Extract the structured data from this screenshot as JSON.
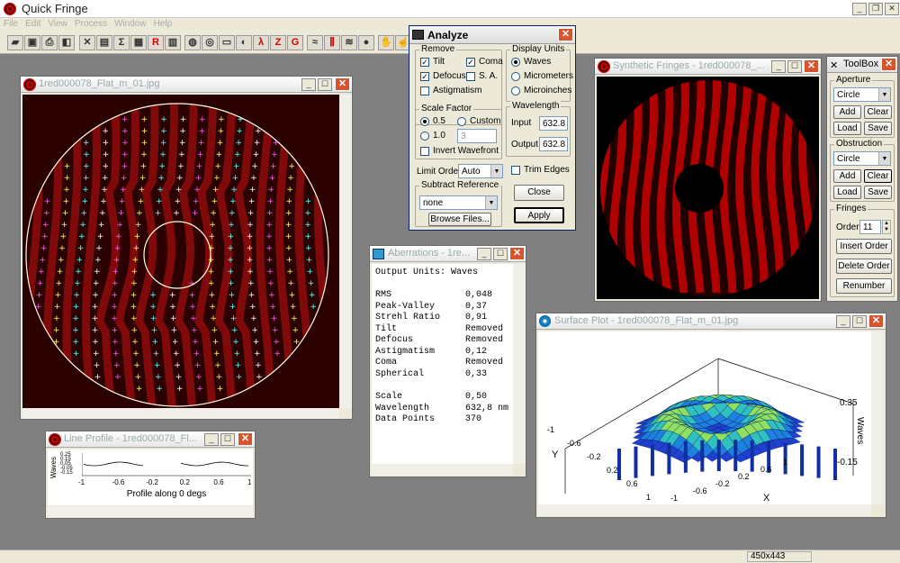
{
  "app": {
    "title": "Quick Fringe"
  },
  "menu": [
    "File",
    "Edit",
    "View",
    "Process",
    "Window",
    "Help"
  ],
  "toolbar": {
    "r_label": "R",
    "z_label": "Z",
    "g_label": "G",
    "lambda_label": "λ"
  },
  "fringe_window": {
    "title": "1red000078_Flat_m_01.jpg"
  },
  "analyze": {
    "title": "Analyze",
    "remove": {
      "label": "Remove",
      "tilt": "Tilt",
      "coma": "Coma",
      "defocus": "Defocus",
      "sa": "S. A.",
      "astig": "Astigmatism"
    },
    "display_units": {
      "label": "Display Units",
      "waves": "Waves",
      "micrometers": "Micrometers",
      "microinches": "Microinches"
    },
    "scale": {
      "label": "Scale Factor",
      "half": "0.5",
      "custom": "Custom",
      "one": "1.0",
      "custom_value": "3",
      "invert": "Invert Wavefront"
    },
    "wavelength": {
      "label": "Wavelength",
      "input_label": "Input",
      "input_value": "632.8",
      "output_label": "Output",
      "output_value": "632.8"
    },
    "limit_order_label": "Limit Order",
    "limit_order_value": "Auto",
    "trim_edges": "Trim Edges",
    "subtract": {
      "label": "Subtract Reference",
      "value": "none",
      "browse": "Browse Files..."
    },
    "close": "Close",
    "apply": "Apply"
  },
  "synthetic": {
    "title": "Synthetic Fringes - 1red000078_..."
  },
  "toolbox": {
    "title": "ToolBox",
    "aperture_label": "Aperture",
    "aperture_value": "Circle",
    "add": "Add",
    "clear": "Clear",
    "load": "Load",
    "save": "Save",
    "obstruction_label": "Obstruction",
    "obstruction_value": "Circle",
    "fringes_label": "Fringes",
    "order_label": "Order",
    "order_value": "11",
    "insert_order": "Insert Order",
    "delete_order": "Delete Order",
    "renumber": "Renumber"
  },
  "aberrations": {
    "title": "Aberrations - 1re...",
    "output_units": "Output Units: Waves",
    "rows": [
      {
        "k": "RMS",
        "v": "0,048"
      },
      {
        "k": "Peak-Valley",
        "v": "0,37"
      },
      {
        "k": "Strehl Ratio",
        "v": "0,91"
      },
      {
        "k": "Tilt",
        "v": "Removed"
      },
      {
        "k": "Defocus",
        "v": "Removed"
      },
      {
        "k": "Astigmatism",
        "v": "0,12"
      },
      {
        "k": "Coma",
        "v": "Removed"
      },
      {
        "k": "Spherical",
        "v": "0,33"
      }
    ],
    "rows2": [
      {
        "k": "Scale",
        "v": "0,50"
      },
      {
        "k": "Wavelength",
        "v": "632,8 nm"
      },
      {
        "k": "Data Points",
        "v": "370"
      }
    ]
  },
  "surface": {
    "title": "Surface Plot - 1red000078_Flat_m_01.jpg",
    "y_label": "Y",
    "x_label": "X",
    "z_label": "Waves",
    "z_top": "0.35",
    "z_bottom": "-0.15",
    "y_ticks": [
      "-1",
      "-0.6",
      "-0.2",
      "0.2",
      "0.6",
      "1"
    ],
    "x_ticks": [
      "-1",
      "-0.6",
      "-0.2",
      "0.2",
      "0.6",
      "1"
    ]
  },
  "line_profile": {
    "title": "Line Profile - 1red000078_Fl...",
    "ylabel": "Waves",
    "xlabel": "Profile along 0 degs",
    "y_ticks": [
      "0.25",
      "0.15",
      "0.05",
      "-0.05",
      "-0.15"
    ],
    "x_ticks": [
      "-1",
      "-0.6",
      "-0.2",
      "0.2",
      "0.6",
      "1"
    ]
  },
  "status": {
    "dims": "450x443"
  },
  "colors": {
    "fringe_red": "#b00000",
    "accent": "#d9542c"
  }
}
